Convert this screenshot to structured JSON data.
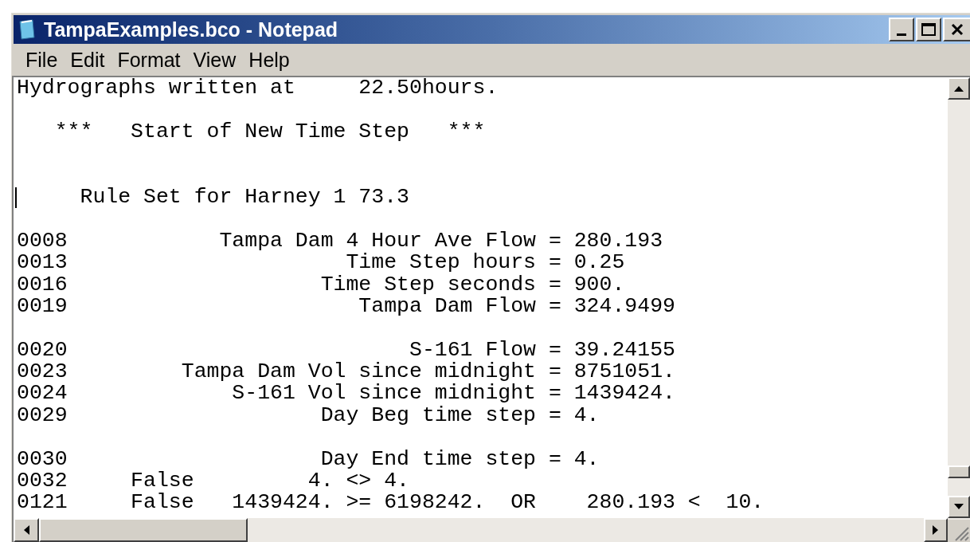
{
  "window": {
    "title": "TampaExamples.bco - Notepad"
  },
  "menu": [
    "File",
    "Edit",
    "Format",
    "View",
    "Help"
  ],
  "lines": [
    {
      "kind": "text",
      "text": "Hydrographs written at     22.50hours.",
      "caret": false
    },
    {
      "kind": "blank"
    },
    {
      "kind": "text",
      "text": "   ***   Start of New Time Step   ***",
      "caret": false
    },
    {
      "kind": "blank"
    },
    {
      "kind": "blank"
    },
    {
      "kind": "text",
      "text": "     Rule Set for Harney 1 73.3",
      "caret": true
    },
    {
      "kind": "blank"
    },
    {
      "kind": "text",
      "text": "0008            Tampa Dam 4 Hour Ave Flow = 280.193",
      "caret": false
    },
    {
      "kind": "text",
      "text": "0013                      Time Step hours = 0.25",
      "caret": false
    },
    {
      "kind": "text",
      "text": "0016                    Time Step seconds = 900.",
      "caret": false
    },
    {
      "kind": "text",
      "text": "0019                       Tampa Dam Flow = 324.9499",
      "caret": false
    },
    {
      "kind": "blank"
    },
    {
      "kind": "text",
      "text": "0020                           S-161 Flow = 39.24155",
      "caret": false
    },
    {
      "kind": "text",
      "text": "0023         Tampa Dam Vol since midnight = 8751051.",
      "caret": false
    },
    {
      "kind": "text",
      "text": "0024             S-161 Vol since midnight = 1439424.",
      "caret": false
    },
    {
      "kind": "text",
      "text": "0029                    Day Beg time step = 4.",
      "caret": false
    },
    {
      "kind": "blank"
    },
    {
      "kind": "text",
      "text": "0030                    Day End time step = 4.",
      "caret": false
    },
    {
      "kind": "text",
      "text": "0032     False         4. <> 4.",
      "caret": false
    },
    {
      "kind": "text",
      "text": "0121     False   1439424. >= 6198242.  OR    280.193 <  10.",
      "caret": false
    }
  ]
}
